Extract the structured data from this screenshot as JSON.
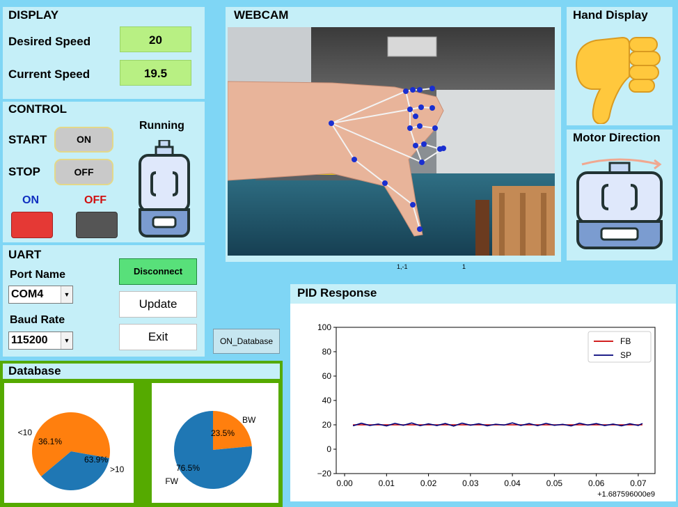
{
  "display": {
    "title": "DISPLAY",
    "desired_label": "Desired Speed",
    "desired_value": "20",
    "current_label": "Current Speed",
    "current_value": "19.5"
  },
  "control": {
    "title": "CONTROL",
    "start_label": "START",
    "start_button": "ON",
    "stop_label": "STOP",
    "stop_button": "OFF",
    "on_indicator_label": "ON",
    "off_indicator_label": "OFF",
    "status": "Running"
  },
  "uart": {
    "title": "UART",
    "port_label": "Port Name",
    "port_value": "COM4",
    "baud_label": "Baud Rate",
    "baud_value": "115200",
    "disconnect_button": "Disconnect",
    "update_button": "Update",
    "exit_button": "Exit"
  },
  "webcam": {
    "title": "WEBCAM",
    "status_left": "1,-1",
    "status_right": "1"
  },
  "hand_display": {
    "title": "Hand Display",
    "icon": "thumbs-down-icon"
  },
  "motor_direction": {
    "title": "Motor Direction",
    "icon": "motor-icon"
  },
  "on_database_button": "ON_Database",
  "database": {
    "title": "Database",
    "pie1": {
      "slices": [
        {
          "label": "<10",
          "pct": "36.1%",
          "value": 36.1
        },
        {
          "label": ">10",
          "pct": "63.9%",
          "value": 63.9
        }
      ]
    },
    "pie2": {
      "slices": [
        {
          "label": "BW",
          "pct": "23.5%",
          "value": 23.5
        },
        {
          "label": "FW",
          "pct": "76.5%",
          "value": 76.5
        }
      ]
    }
  },
  "pid": {
    "title": "PID Response",
    "offset_text": "+1.687596000e9"
  },
  "colors": {
    "background": "#7fd6f5",
    "panel": "#c5eff8",
    "value_box": "#b8f083",
    "database_frame": "#55aa00",
    "led_on": "#e53935",
    "led_off": "#555555",
    "pie_blue": "#1f77b4",
    "pie_orange": "#ff7f0e",
    "fb_line": "#cc0000",
    "sp_line": "#00007a"
  },
  "chart_data": {
    "type": "line",
    "title": "",
    "xlabel": "",
    "ylabel": "",
    "xlim": [
      -0.002,
      0.074
    ],
    "ylim": [
      -20,
      100
    ],
    "xticks": [
      "0.00",
      "0.01",
      "0.02",
      "0.03",
      "0.04",
      "0.05",
      "0.06",
      "0.07"
    ],
    "yticks": [
      "100",
      "80",
      "60",
      "40",
      "20",
      "0",
      "−20"
    ],
    "legend": "top-right",
    "x": [
      0.002,
      0.004,
      0.006,
      0.008,
      0.01,
      0.012,
      0.014,
      0.016,
      0.018,
      0.02,
      0.022,
      0.024,
      0.026,
      0.028,
      0.03,
      0.032,
      0.034,
      0.036,
      0.038,
      0.04,
      0.042,
      0.044,
      0.046,
      0.048,
      0.05,
      0.052,
      0.054,
      0.056,
      0.058,
      0.06,
      0.062,
      0.064,
      0.066,
      0.068,
      0.07,
      0.071
    ],
    "series": [
      {
        "name": "FB",
        "color": "#cc0000",
        "values": [
          20,
          20,
          20,
          20,
          20,
          20,
          20,
          20,
          20,
          20,
          20,
          20,
          20,
          20,
          20,
          20,
          20,
          20,
          20,
          20,
          20,
          20,
          20,
          20,
          20,
          20,
          20,
          20,
          20,
          20,
          20,
          20,
          20,
          20,
          20,
          20
        ]
      },
      {
        "name": "SP",
        "color": "#00007a",
        "values": [
          19.2,
          21.3,
          19.5,
          20.6,
          19.1,
          21.2,
          19.6,
          21.5,
          19.3,
          20.8,
          19.4,
          21.1,
          19.0,
          21.4,
          19.7,
          20.9,
          19.2,
          20.5,
          19.8,
          21.6,
          19.5,
          21.0,
          19.3,
          21.2,
          19.6,
          20.4,
          19.1,
          21.3,
          19.8,
          21.0,
          19.4,
          20.6,
          19.2,
          20.9,
          19.5,
          21.1
        ]
      }
    ]
  }
}
